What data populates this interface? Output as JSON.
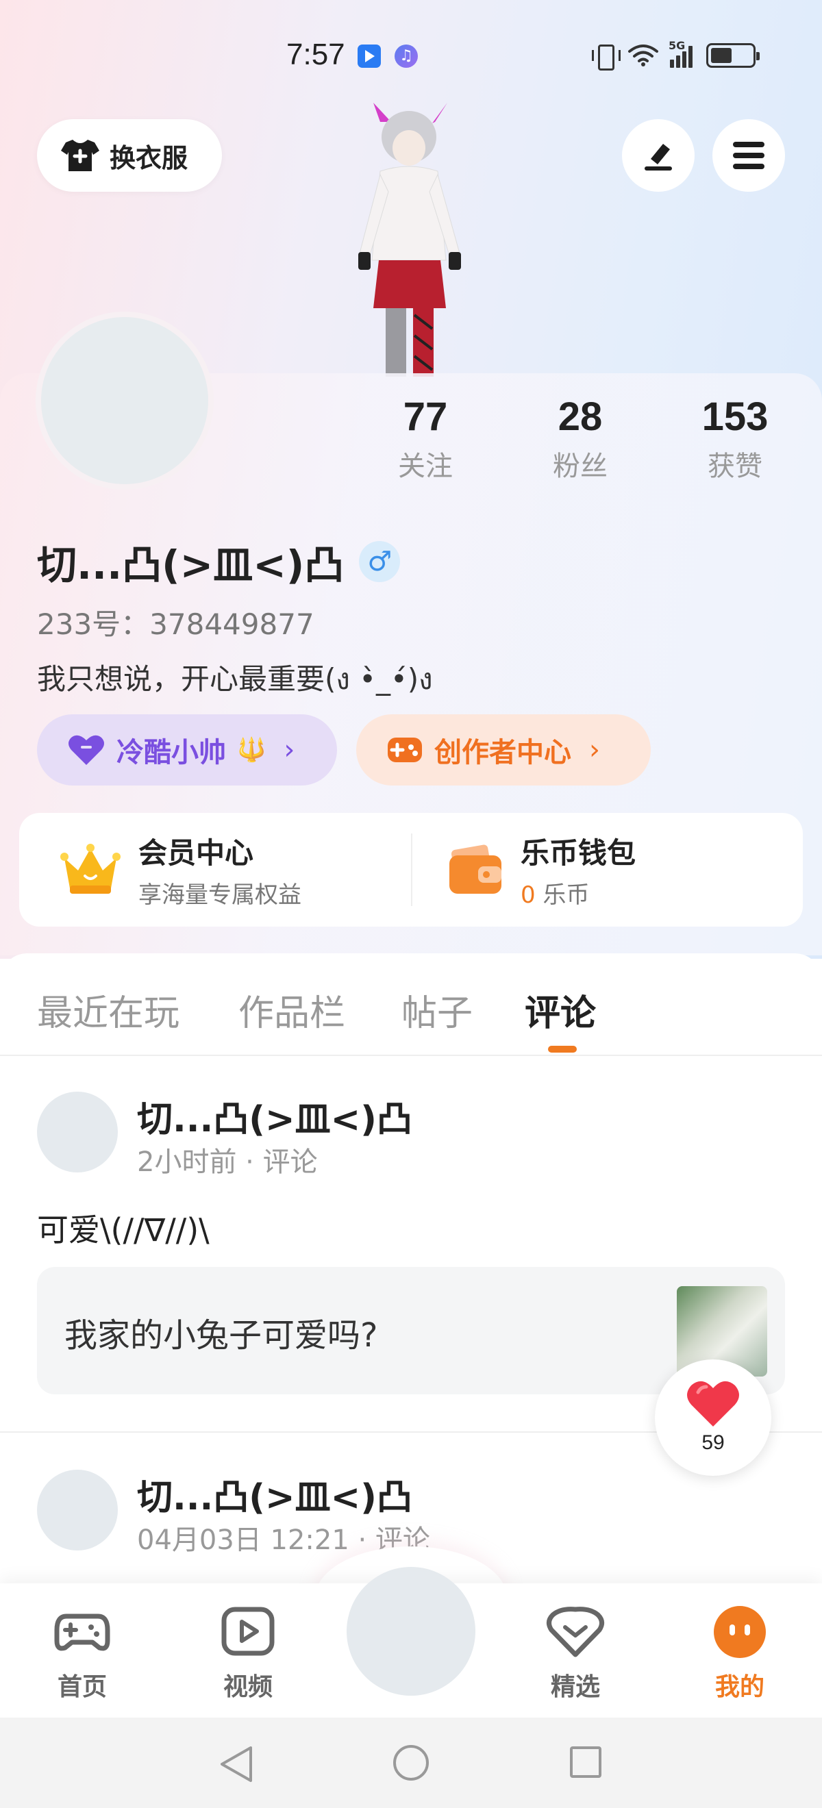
{
  "status_bar": {
    "time": "7:57",
    "app_icon_2": "♫",
    "signal_label": "5G"
  },
  "header": {
    "outfit_button_label": "换衣服"
  },
  "profile": {
    "stats": [
      {
        "value": "77",
        "label": "关注"
      },
      {
        "value": "28",
        "label": "粉丝"
      },
      {
        "value": "153",
        "label": "获赞"
      }
    ],
    "nickname": "切...凸(>皿<)凸",
    "gender_symbol": "♂",
    "uid": "233号：378449877",
    "signature": "我只想说，开心最重要(ง •̀_•́)ง",
    "title_pill": {
      "label": "冷酷小帅",
      "emoji": "🔱",
      "chevron": "›"
    },
    "creator_pill": {
      "label": "创作者中心",
      "chevron": "›"
    }
  },
  "vip": {
    "member_title": "会员中心",
    "member_sub": "享海量专属权益",
    "wallet_title": "乐币钱包",
    "wallet_amount": "0",
    "wallet_unit": "乐币"
  },
  "tabs": [
    {
      "label": "最近在玩"
    },
    {
      "label": "作品栏"
    },
    {
      "label": "帖子"
    },
    {
      "label": "评论"
    }
  ],
  "feed": [
    {
      "name": "切...凸(>皿<)凸",
      "meta": "2小时前 · 评论",
      "text": "可爱\\(//∇//)\\",
      "quote": "我家的小兔子可爱吗?"
    },
    {
      "name": "切...凸(>皿<)凸",
      "meta": "04月03日 12:21 · 评论"
    }
  ],
  "like_float": {
    "count": "59"
  },
  "bottom_nav": [
    {
      "label": "首页"
    },
    {
      "label": "视频"
    },
    {
      "label": "精选"
    },
    {
      "label": "我的"
    }
  ],
  "colors": {
    "accent": "#f07a20",
    "purple": "#7a4fe0",
    "heart": "#f0384a"
  }
}
